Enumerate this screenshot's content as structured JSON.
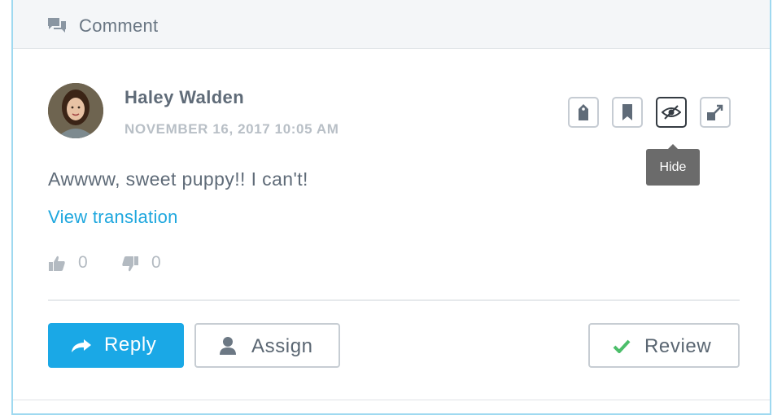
{
  "header": {
    "title": "Comment",
    "icon": "comments-icon"
  },
  "comment": {
    "author": "Haley Walden",
    "timestamp": "NOVEMBER 16, 2017 10:05 AM",
    "text": "Awwww, sweet puppy!! I can't!",
    "translate_link": "View translation",
    "likes": "0",
    "dislikes": "0"
  },
  "actions": {
    "icons": [
      "tag-icon",
      "bookmark-icon",
      "eye-slash-icon",
      "expand-icon"
    ],
    "tooltip": "Hide"
  },
  "buttons": {
    "reply": "Reply",
    "assign": "Assign",
    "review": "Review"
  },
  "colors": {
    "accent": "#1aa8e6",
    "panel_border": "#9fd9f0",
    "check": "#4cbe6a",
    "tooltip_bg": "#6b6b6b"
  }
}
